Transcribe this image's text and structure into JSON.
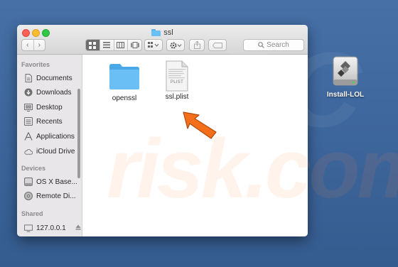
{
  "window": {
    "title": "ssl",
    "nav": {
      "back_glyph": "‹",
      "forward_glyph": "›"
    },
    "search": {
      "placeholder": "Search"
    }
  },
  "sidebar": {
    "favorites_header": "Favorites",
    "devices_header": "Devices",
    "shared_header": "Shared",
    "favorites": [
      {
        "label": "Documents",
        "icon": "document-icon"
      },
      {
        "label": "Downloads",
        "icon": "download-icon"
      },
      {
        "label": "Desktop",
        "icon": "desktop-icon"
      },
      {
        "label": "Recents",
        "icon": "recents-icon"
      },
      {
        "label": "Applications",
        "icon": "applications-icon"
      },
      {
        "label": "iCloud Drive",
        "icon": "cloud-icon"
      }
    ],
    "devices": [
      {
        "label": "OS X Base...",
        "icon": "disk-icon"
      },
      {
        "label": "Remote Di...",
        "icon": "remote-disc-icon"
      }
    ],
    "shared": [
      {
        "label": "127.0.0.1",
        "icon": "server-icon"
      }
    ]
  },
  "files": [
    {
      "name": "openssl",
      "kind": "folder"
    },
    {
      "name": "ssl.plist",
      "kind": "plist",
      "badge": "PLIST"
    }
  ],
  "desktop": {
    "drive_label": "Install-LOL"
  },
  "watermark": "risk.com",
  "colors": {
    "desktop": "#3f6aa1",
    "folder": "#6ac0f5",
    "arrow": "#f36f1c",
    "selected_view": "#6d6d6d"
  }
}
